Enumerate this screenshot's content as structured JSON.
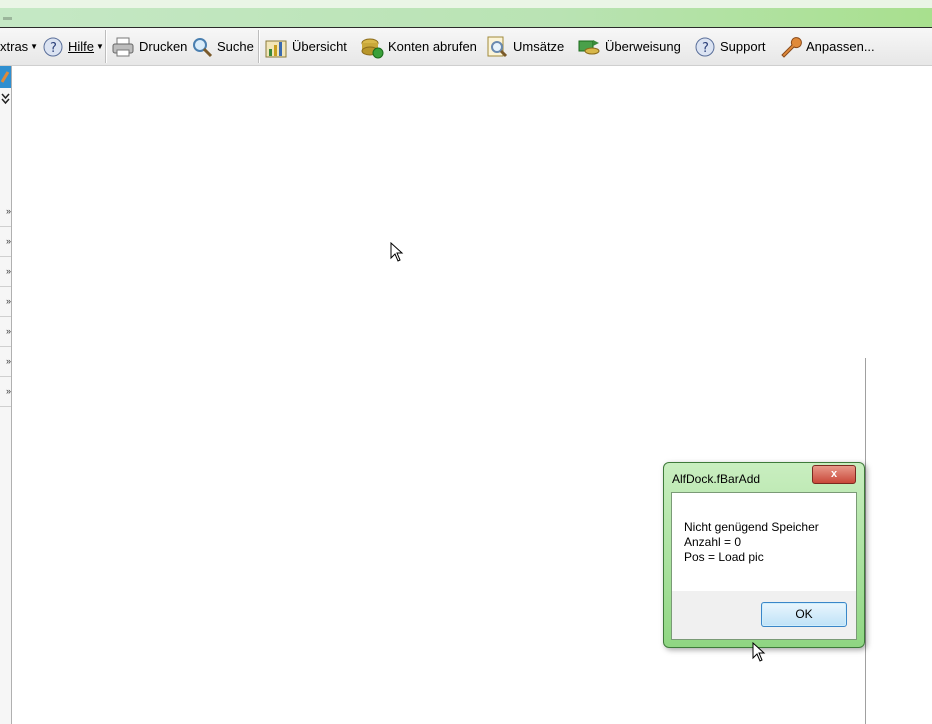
{
  "toolbar": {
    "extras_label": "xtras",
    "hilfe_label": "Hilfe",
    "drucken_label": "Drucken",
    "suche_label": "Suche",
    "uebersicht_label": "Übersicht",
    "konten_label": "Konten abrufen",
    "umsaetze_label": "Umsätze",
    "ueberweisung_label": "Überweisung",
    "support_label": "Support",
    "anpassen_label": "Anpassen..."
  },
  "left_panel": {
    "chevron": "»",
    "double_down": "⌄"
  },
  "dialog": {
    "title": "AlfDock.fBarAdd",
    "close_label": "x",
    "message_lines": [
      "Nicht genügend Speicher",
      "Anzahl = 0",
      "Pos = Load pic"
    ],
    "ok_label": "OK"
  },
  "colors": {
    "titlebar_green": "#b9e3b3",
    "dialog_frame": "#8fd682",
    "close_red": "#c9483a",
    "ok_blue": "#3a86c8"
  }
}
